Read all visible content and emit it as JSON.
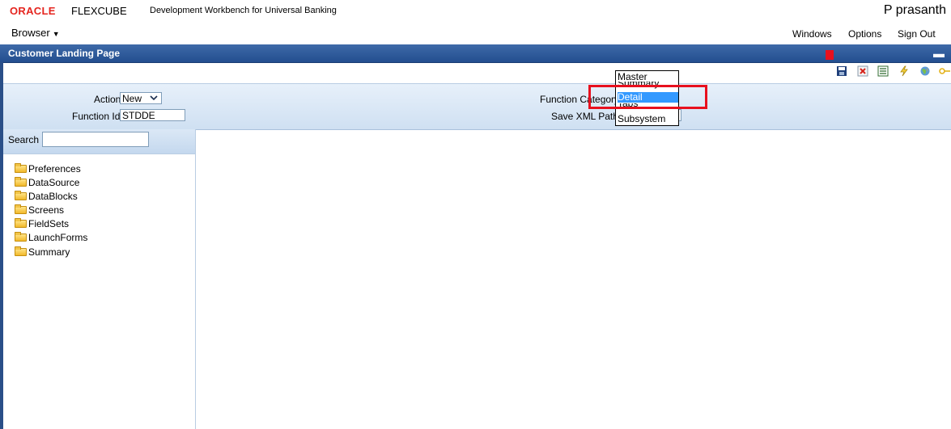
{
  "header": {
    "brand_oracle": "ORACLE",
    "brand_product": "FLEXCUBE",
    "app_title": "Development Workbench for Universal Banking",
    "user_name": "P prasanth"
  },
  "menu": {
    "browser_label": "Browser",
    "windows_label": "Windows",
    "options_label": "Options",
    "signout_label": "Sign Out"
  },
  "page": {
    "title": "Customer Landing Page"
  },
  "toolbar": {
    "icons": [
      "save-icon",
      "close-icon",
      "list-icon",
      "lightning-icon",
      "globe-icon",
      "key-icon"
    ]
  },
  "form": {
    "action_label": "Action",
    "action_value": "New",
    "function_id_label": "Function Id",
    "function_id_value": "STDDE",
    "function_category_label": "Function Category",
    "save_xml_path_label": "Save XML Path"
  },
  "dropdown": {
    "options": [
      "Master",
      "Summary",
      "Detail",
      "Tabs",
      "Subsystem"
    ],
    "selected": "Detail"
  },
  "tree": {
    "search_label": "Search",
    "items": [
      "Preferences",
      "DataSource",
      "DataBlocks",
      "Screens",
      "FieldSets",
      "LaunchForms",
      "Summary"
    ]
  },
  "colors": {
    "brand_red": "#e5251f",
    "header_blue": "#234e8f",
    "selection_blue": "#3399ff",
    "highlight_red": "#e8101e"
  }
}
